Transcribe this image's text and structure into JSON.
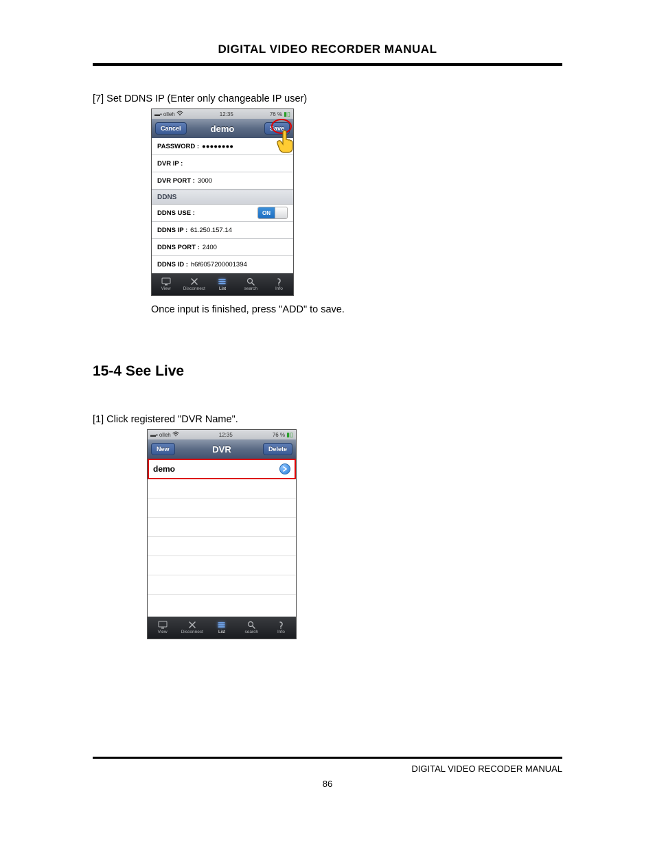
{
  "header_title": "DIGITAL VIDEO RECORDER MANUAL",
  "step7": "[7] Set DDNS IP (Enter only changeable IP user)",
  "caption7": "Once input is finished, press \"ADD\" to save.",
  "section_heading": "15-4 See Live",
  "step1": "[1] Click registered \"DVR Name\".",
  "footer_text": "DIGITAL VIDEO RECODER MANUAL",
  "page_number": "86",
  "phone1": {
    "carrier": "olleh",
    "time": "12:35",
    "battery": "76 %",
    "nav_left": "Cancel",
    "nav_title": "demo",
    "nav_right": "Save",
    "row_password_label": "PASSWORD :",
    "row_password_value": "●●●●●●●●",
    "row_dvrip_label": "DVR IP :",
    "row_dvrip_value": "",
    "row_dvrport_label": "DVR PORT :",
    "row_dvrport_value": "3000",
    "section_ddns": "DDNS",
    "row_ddnsuse_label": "DDNS USE :",
    "toggle_on": "ON",
    "row_ddnsip_label": "DDNS IP :",
    "row_ddnsip_value": "61.250.157.14",
    "row_ddnsport_label": "DDNS PORT :",
    "row_ddnsport_value": "2400",
    "row_ddnsid_label": "DDNS ID :",
    "row_ddnsid_value": "h6f6057200001394",
    "tabs": [
      "View",
      "Disconnect",
      "List",
      "search",
      "Info"
    ]
  },
  "phone2": {
    "carrier": "olleh",
    "time": "12:35",
    "battery": "76 %",
    "nav_left": "New",
    "nav_title": "DVR",
    "nav_right": "Delete",
    "dvr_name": "demo",
    "tabs": [
      "View",
      "Disconnect",
      "List",
      "search",
      "Info"
    ]
  }
}
